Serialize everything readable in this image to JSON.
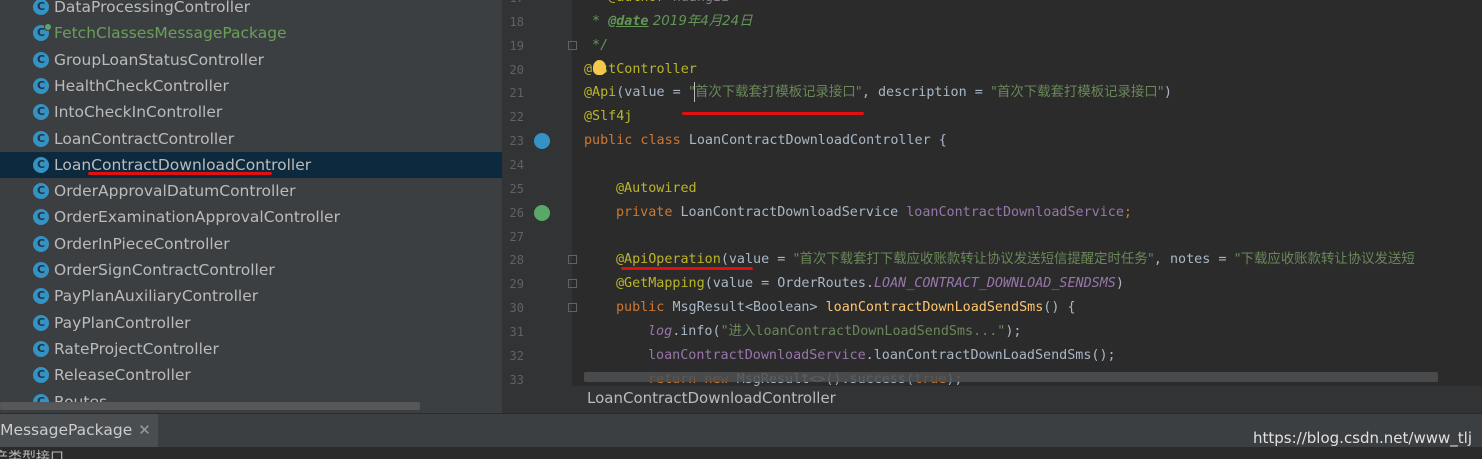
{
  "project_tree": {
    "items": [
      {
        "label": "DataProcessingController",
        "icon": "class-icon",
        "selected": false,
        "green": false
      },
      {
        "label": "FetchClassesMessagePackage",
        "icon": "class-icon",
        "selected": false,
        "green": true
      },
      {
        "label": "GroupLoanStatusController",
        "icon": "class-icon",
        "selected": false,
        "green": false
      },
      {
        "label": "HealthCheckController",
        "icon": "class-icon",
        "selected": false,
        "green": false
      },
      {
        "label": "IntoCheckInController",
        "icon": "class-icon",
        "selected": false,
        "green": false
      },
      {
        "label": "LoanContractController",
        "icon": "class-icon",
        "selected": false,
        "green": false
      },
      {
        "label": "LoanContractDownloadController",
        "icon": "class-icon",
        "selected": true,
        "green": false
      },
      {
        "label": "OrderApprovalDatumController",
        "icon": "class-icon",
        "selected": false,
        "green": false
      },
      {
        "label": "OrderExaminationApprovalController",
        "icon": "class-icon",
        "selected": false,
        "green": false
      },
      {
        "label": "OrderInPieceController",
        "icon": "class-icon",
        "selected": false,
        "green": false
      },
      {
        "label": "OrderSignContractController",
        "icon": "class-icon",
        "selected": false,
        "green": false
      },
      {
        "label": "PayPlanAuxiliaryController",
        "icon": "class-icon",
        "selected": false,
        "green": false
      },
      {
        "label": "PayPlanController",
        "icon": "class-icon",
        "selected": false,
        "green": false
      },
      {
        "label": "RateProjectController",
        "icon": "class-icon",
        "selected": false,
        "green": false
      },
      {
        "label": "ReleaseController",
        "icon": "class-icon",
        "selected": false,
        "green": false
      },
      {
        "label": "Routes",
        "icon": "class-icon",
        "selected": false,
        "green": false
      }
    ],
    "class_icon_letter": "C"
  },
  "editor": {
    "line_numbers": [
      "17",
      "18",
      "19",
      "20",
      "21",
      "22",
      "23",
      "24",
      "25",
      "26",
      "27",
      "28",
      "29",
      "30",
      "31",
      "32",
      "33"
    ],
    "lines": {
      "l17_author": "@author",
      "l17_name": "huangzi",
      "l18_star": " * ",
      "l18_tag": "@date",
      "l18_val": " 2019年4月24日",
      "l19": " */",
      "l20_at": "@",
      "l20_rest": "estController",
      "l21_ann": "@Api",
      "l21_a": "(value = ",
      "l21_s1": "\"首次下载套打模板记录接口\"",
      "l21_b": ", description = ",
      "l21_s2": "\"首次下载套打模板记录接口\"",
      "l21_c": ")",
      "l22": "@Slf4j",
      "l23_kw": "public class ",
      "l23_rest": "LoanContractDownloadController {",
      "l25": "@Autowired",
      "l26_kw": "private ",
      "l26_type": "LoanContractDownloadService ",
      "l26_fld": "loanContractDownloadService",
      "l26_semi": ";",
      "l28_ann": "@ApiOperation",
      "l28_a": "(value = ",
      "l28_s1": "\"首次下载套打下载应收账款转让协议发送短信提醒定时任务\"",
      "l28_b": ", notes = ",
      "l28_s2": "\"下载应收账款转让协议发送短",
      "l29_ann": "@GetMapping",
      "l29_a": "(value = OrderRoutes.",
      "l29_const": "LOAN_CONTRACT_DOWNLOAD_SENDSMS",
      "l29_b": ")",
      "l30_kw": "public ",
      "l30_type": "MsgResult",
      "l30_gen": "<Boolean> ",
      "l30_fn": "loanContractDownLoadSendSms",
      "l30_rest": "() {",
      "l31_log": "log",
      "l31_a": ".info(",
      "l31_s": "\"进入loanContractDownLoadSendSms...\"",
      "l31_b": ");",
      "l32_fld": "loanContractDownloadService",
      "l32_rest": ".loanContractDownLoadSendSms();",
      "l33_kw": "return new ",
      "l33_a": "MsgResult",
      "l33_gen": "<>",
      "l33_b": "().success(",
      "l33_kw2": "true",
      "l33_c": ");"
    }
  },
  "breadcrumb": {
    "label": "LoanContractDownloadController"
  },
  "bottom_tab": {
    "label": "sMessagePackage",
    "close": "✕"
  },
  "watermark": "https://blog.csdn.net/www_tlj",
  "console": {
    "text": "产类型接口"
  },
  "colors": {
    "annotation": "#bbb529",
    "keyword": "#cc7832",
    "string": "#6a8759",
    "field": "#9876aa",
    "underline": "#e01010",
    "selection": "#0d293e"
  }
}
